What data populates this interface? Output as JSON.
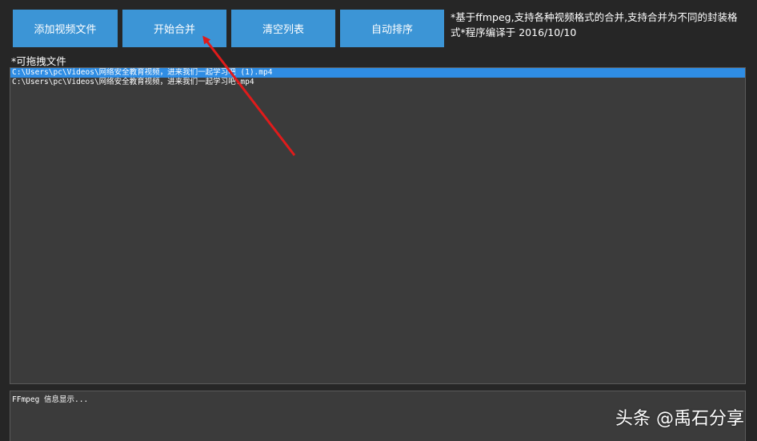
{
  "toolbar": {
    "add_label": "添加视频文件",
    "merge_label": "开始合并",
    "clear_label": "清空列表",
    "sort_label": "自动排序"
  },
  "info": {
    "text": "*基于ffmpeg,支持各种视频格式的合并,支持合并为不同的封装格式*程序编译于 2016/10/10"
  },
  "drop_hint": "*可拖拽文件",
  "files": [
    {
      "path": "C:\\Users\\pc\\Videos\\网络安全教育视频，进来我们一起学习吧 (1).mp4",
      "selected": true
    },
    {
      "path": "C:\\Users\\pc\\Videos\\网络安全教育视频，进来我们一起学习吧.mp4",
      "selected": false
    }
  ],
  "log": {
    "text": "FFmpeg 信息显示..."
  },
  "watermark": "头条 @禹石分享",
  "colors": {
    "button_bg": "#3c95d6",
    "selection": "#2f8de4",
    "annotation_arrow": "#e01b1b"
  }
}
